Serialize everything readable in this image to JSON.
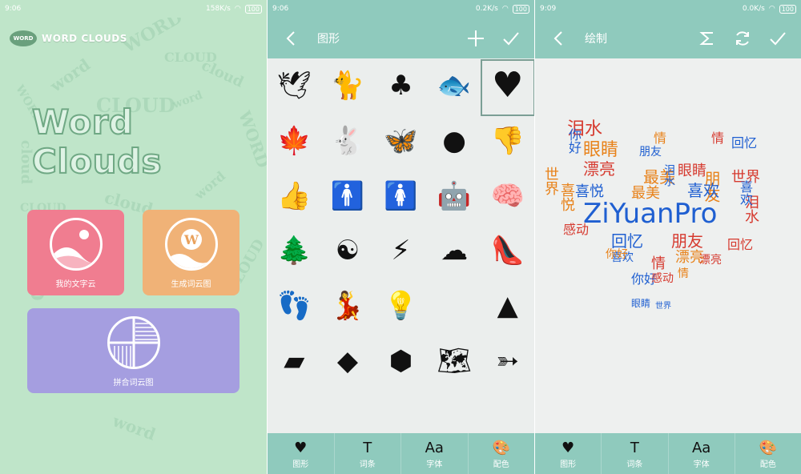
{
  "colors": {
    "teal_bar": "#8fcabd",
    "mint_bg": "#bfe5c9",
    "tile_pink": "#f07d90",
    "tile_orange": "#f0b277",
    "tile_purple": "#a59ee0",
    "cloud_blue": "#1f5fd1",
    "cloud_orange": "#e8821a",
    "cloud_red": "#d63a2f"
  },
  "panel1": {
    "status": {
      "time": "9:06",
      "speed": "158K/s",
      "battery": "100"
    },
    "brand": {
      "logo": "WORD CLOUDS",
      "text": "WORD CLOUDS"
    },
    "hero_title": "Word Clouds",
    "bg_words": [
      "WORD",
      "CLOUD",
      "word",
      "cloud",
      "WORD",
      "CLOUD",
      "word",
      "cloud",
      "WORD",
      "CLOUD",
      "word",
      "cloud",
      "WORD",
      "CLOUD",
      "word"
    ],
    "tiles": [
      {
        "label": "我的文字云",
        "icon": "landscape-icon"
      },
      {
        "label": "生成词云图",
        "icon": "w-letter-icon",
        "glyph": "W"
      },
      {
        "label": "拼合词云图",
        "icon": "collage-icon"
      }
    ]
  },
  "panel2": {
    "status": {
      "time": "9:06",
      "speed": "0.2K/s",
      "battery": "100"
    },
    "title": "图形",
    "shapes": [
      {
        "name": "bird-icon",
        "glyph": "🕊"
      },
      {
        "name": "cat-icon",
        "glyph": "🐈"
      },
      {
        "name": "clover-icon",
        "glyph": "♣"
      },
      {
        "name": "fish-icon",
        "glyph": "🐟"
      },
      {
        "name": "heart-icon",
        "glyph": "♥"
      },
      {
        "name": "maple-leaf-icon",
        "glyph": "🍁"
      },
      {
        "name": "rabbit-icon",
        "glyph": "🐇"
      },
      {
        "name": "butterfly-icon",
        "glyph": "🦋"
      },
      {
        "name": "mouse-ears-icon",
        "glyph": "●"
      },
      {
        "name": "thumbs-down-icon",
        "glyph": "👎"
      },
      {
        "name": "thumbs-up-icon",
        "glyph": "👍"
      },
      {
        "name": "man-icon",
        "glyph": "🚹"
      },
      {
        "name": "woman-icon",
        "glyph": "🚺"
      },
      {
        "name": "android-icon",
        "glyph": "🤖"
      },
      {
        "name": "brain-icon",
        "glyph": "🧠"
      },
      {
        "name": "tree-icon",
        "glyph": "🌲"
      },
      {
        "name": "yin-yang-icon",
        "glyph": "☯"
      },
      {
        "name": "lightning-icon",
        "glyph": "⚡"
      },
      {
        "name": "cloud-icon",
        "glyph": "☁"
      },
      {
        "name": "high-heel-icon",
        "glyph": "👠"
      },
      {
        "name": "footprint-icon",
        "glyph": "👣"
      },
      {
        "name": "dancer-icon",
        "glyph": "💃"
      },
      {
        "name": "lightbulb-icon",
        "glyph": "💡"
      },
      {
        "name": "apple-icon",
        "glyph": ""
      },
      {
        "name": "uk-map-icon",
        "glyph": "▲"
      },
      {
        "name": "australia-map-icon",
        "glyph": "▰"
      },
      {
        "name": "africa-map-icon",
        "glyph": "◆"
      },
      {
        "name": "france-map-icon",
        "glyph": "⬢"
      },
      {
        "name": "world-map-icon",
        "glyph": "🗺"
      },
      {
        "name": "arrow-icon",
        "glyph": "➳"
      }
    ],
    "tabs": [
      {
        "label": "图形",
        "icon": "heart-icon",
        "glyph": "♥"
      },
      {
        "label": "词条",
        "icon": "text-icon",
        "glyph": "T"
      },
      {
        "label": "字体",
        "icon": "font-icon",
        "glyph": "Aa"
      },
      {
        "label": "配色",
        "icon": "palette-icon",
        "glyph": "🎨"
      }
    ]
  },
  "panel3": {
    "status": {
      "time": "9:09",
      "speed": "0.0K/s",
      "battery": "100"
    },
    "title": "绘制",
    "cloud_words": [
      "ZiYuanPro",
      "泪水",
      "你好",
      "眼睛",
      "漂亮",
      "最美",
      "喜悦",
      "世界",
      "情",
      "朋友",
      "回忆",
      "喜欢",
      "世界",
      "眼睛",
      "最美",
      "喜悦",
      "泪水",
      "回忆",
      "朋友",
      "漂亮",
      "情",
      "你好",
      "感动",
      "喜欢",
      "情",
      "泪水",
      "回忆",
      "朋友",
      "你好",
      "漂亮",
      "情",
      "喜欢",
      "眼睛",
      "感动",
      "世界"
    ],
    "tabs": [
      {
        "label": "图形",
        "icon": "heart-icon",
        "glyph": "♥"
      },
      {
        "label": "词条",
        "icon": "text-icon",
        "glyph": "T"
      },
      {
        "label": "字体",
        "icon": "font-icon",
        "glyph": "Aa"
      },
      {
        "label": "配色",
        "icon": "palette-icon",
        "glyph": "🎨"
      }
    ]
  }
}
